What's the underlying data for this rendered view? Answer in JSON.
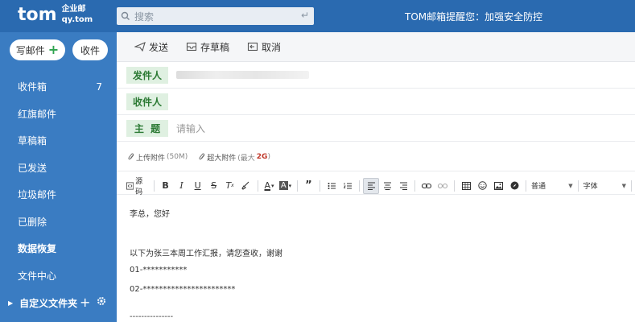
{
  "header": {
    "logo_main": "tom",
    "logo_sub_line1": "企业邮",
    "logo_sub_line2": "qy.tom",
    "search_placeholder": "搜索",
    "notice": "TOM邮箱提醒您：加强安全防控"
  },
  "sidebar": {
    "compose_label": "写邮件",
    "receive_label": "收件",
    "items": [
      {
        "label": "收件箱",
        "count": "7"
      },
      {
        "label": "红旗邮件"
      },
      {
        "label": "草稿箱"
      },
      {
        "label": "已发送"
      },
      {
        "label": "垃圾邮件"
      },
      {
        "label": "已删除"
      },
      {
        "label": "数据恢复"
      },
      {
        "label": "文件中心"
      }
    ],
    "custom_folder": "自定义文件夹"
  },
  "toolbar": {
    "send": "发送",
    "draft": "存草稿",
    "cancel": "取消"
  },
  "compose": {
    "from_label": "发件人",
    "to_label": "收件人",
    "subject_label": "主  题",
    "subject_placeholder": "请输入"
  },
  "attachments": {
    "upload_label": "上传附件",
    "upload_limit": "(50M)",
    "big_label": "超大附件",
    "big_limit_prefix": "(最大",
    "big_limit_value": "2G",
    "big_limit_suffix": ")"
  },
  "editor": {
    "source_label": "源码",
    "paragraph_select": "普通",
    "font_select": "字体"
  },
  "body": {
    "lines": [
      "李总，您好",
      "以下为张三本周工作汇报，请您查收，谢谢",
      "01-***********",
      "02-***********************",
      "---------------"
    ]
  },
  "colors": {
    "topbar": "#2a6ab0",
    "sidebar": "#3a7cc2",
    "label_bg": "#dff0e1",
    "label_text": "#2c7a34",
    "accent_red": "#c0392b"
  }
}
